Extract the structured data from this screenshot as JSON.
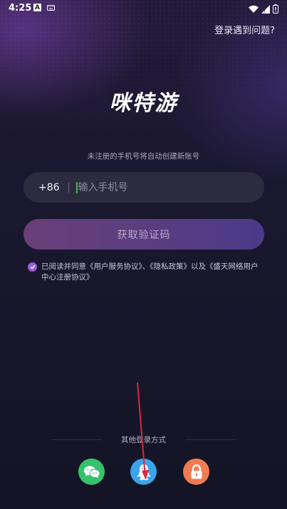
{
  "status_bar": {
    "time": "4:25",
    "icons": [
      "a-notification-icon",
      "keyboard-icon",
      "wifi-icon",
      "signal-icon",
      "battery-icon"
    ],
    "a_label": "A"
  },
  "header": {
    "help_link": "登录遇到问题?"
  },
  "logo": {
    "text": "咪特游"
  },
  "hint": "未注册的手机号将自动创建新账号",
  "phone": {
    "country_code": "+86",
    "placeholder": "输入手机号",
    "value": ""
  },
  "get_code_button": "获取验证码",
  "agreement": {
    "checked": true,
    "text": "已阅读并同意《用户服务协议》、《隐私政策》以及《盛天网络用户中心注册协议》"
  },
  "other_login": {
    "title": "其他登录方式",
    "options": [
      "wechat-icon",
      "qq-icon",
      "lock-icon"
    ]
  },
  "colors": {
    "accent": "#9a5dd6",
    "wechat": "#34c26a",
    "qq": "#3aa3ea",
    "lock": "#f27b52",
    "annotation_arrow": "#d9283a"
  }
}
